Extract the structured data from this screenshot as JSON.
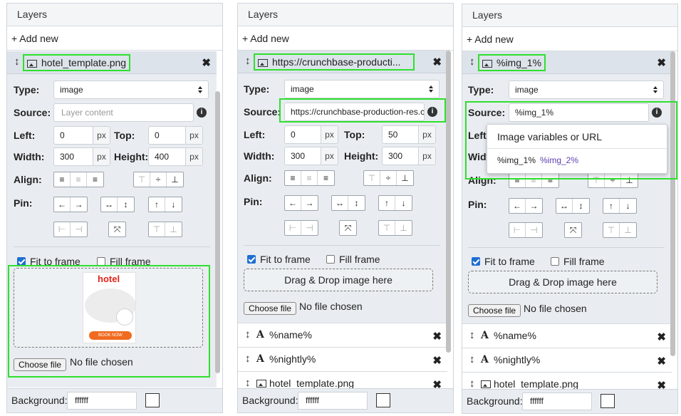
{
  "panels": [
    {
      "title": "Layers",
      "add_new": "+ Add new",
      "layer_name": "hotel_template.png",
      "type_label": "Type:",
      "type_value": "image",
      "source_label": "Source:",
      "source_placeholder": "Layer content",
      "left_label": "Left:",
      "left_value": "0",
      "top_label": "Top:",
      "top_value": "0",
      "width_label": "Width:",
      "width_value": "300",
      "height_label": "Height:",
      "height_value": "400",
      "unit": "px",
      "align_label": "Align:",
      "pin_label": "Pin:",
      "fit_label": "Fit to frame",
      "fit_checked": true,
      "fill_label": "Fill frame",
      "fill_checked": false,
      "choose_file": "Choose file",
      "no_file": "No file chosen",
      "preview_brand": "hotel",
      "preview_button": "BOOK NOW",
      "background_label": "Background:",
      "background_value": "ffffff"
    },
    {
      "title": "Layers",
      "add_new": "+ Add new",
      "layer_name": "https://crunchbase-producti...",
      "type_label": "Type:",
      "type_value": "image",
      "source_label": "Source:",
      "source_value": "https://crunchbase-production-res.cl",
      "left_label": "Left:",
      "left_value": "0",
      "top_label": "Top:",
      "top_value": "50",
      "width_label": "Width:",
      "width_value": "300",
      "height_label": "Height:",
      "height_value": "300",
      "unit": "px",
      "align_label": "Align:",
      "pin_label": "Pin:",
      "fit_label": "Fit to frame",
      "fit_checked": true,
      "fill_label": "Fill frame",
      "fill_checked": false,
      "drop_text": "Drag & Drop image here",
      "choose_file": "Choose file",
      "no_file": "No file chosen",
      "layers": [
        "%name%",
        "%nightly%",
        "hotel_template.png"
      ],
      "background_label": "Background:",
      "background_value": "ffffff"
    },
    {
      "title": "Layers",
      "add_new": "+ Add new",
      "layer_name": "%img_1%",
      "type_label": "Type:",
      "type_value": "image",
      "source_label": "Source:",
      "source_value": "%img_1%",
      "left_label": "Left",
      "width_label": "Widt",
      "align_label": "Align:",
      "pin_label": "Pin:",
      "dropdown_title": "Image variables or URL",
      "dropdown_options": [
        "%img_1%",
        "%img_2%"
      ],
      "fit_label": "Fit to frame",
      "fit_checked": true,
      "fill_label": "Fill frame",
      "fill_checked": false,
      "drop_text": "Drag & Drop image here",
      "choose_file": "Choose file",
      "no_file": "No file chosen",
      "layers": [
        "%name%",
        "%nightly%",
        "hotel_template.png"
      ],
      "background_label": "Background:",
      "background_value": "ffffff"
    }
  ],
  "icons": {
    "move": "↕",
    "close": "✖",
    "info": "i",
    "text_layer": "A",
    "align_left": "≡",
    "align_center": "≡",
    "align_right": "≡",
    "valign_top": "⊤",
    "valign_middle": "÷",
    "valign_bottom": "⊥",
    "arrow_left": "←",
    "arrow_right": "→",
    "arrow_horiz": "↔",
    "arrow_vert": "↕",
    "arrow_up": "↑",
    "arrow_down": "↓",
    "pin_h1": "⊢",
    "pin_h2": "⊣",
    "expand": "⤧",
    "pin_v1": "⊤",
    "pin_v2": "⊥"
  },
  "colors": {
    "highlight": "#2ee02e",
    "link": "#5c3fb0",
    "checkbox": "#1f6fd1"
  }
}
